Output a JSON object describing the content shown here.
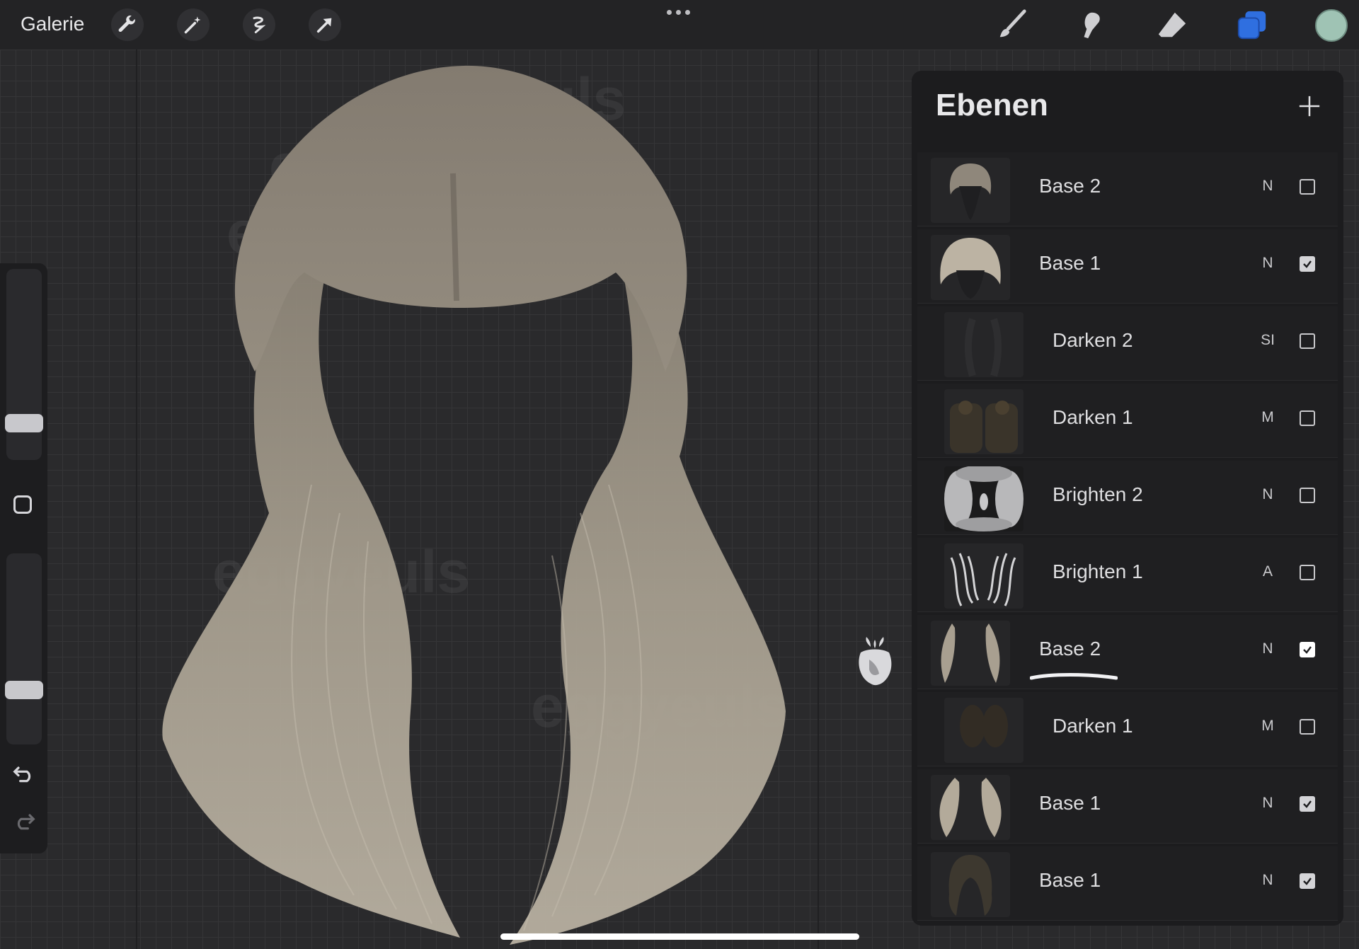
{
  "app": {
    "gallery_label": "Galerie",
    "accent_color": "#2f6fe0",
    "current_color": "#9fc3b4"
  },
  "toolbar": {
    "left_tools": [
      "wrench-icon",
      "magic-wand-icon",
      "selection-icon",
      "transform-arrow-icon"
    ],
    "right_tools": [
      "brush-icon",
      "smudge-icon",
      "eraser-icon",
      "layers-icon"
    ],
    "more_icon": "more-dots-icon"
  },
  "watermark": {
    "text": "eggyeuls"
  },
  "sidebar": {
    "brush_size_level": 0.18,
    "opacity_level": 0.15,
    "icons": [
      "modifier-square-icon",
      "undo-icon",
      "redo-icon"
    ]
  },
  "layers_panel": {
    "title": "Ebenen",
    "add_icon": "plus-icon",
    "layers": [
      {
        "name": "Base 2",
        "blend": "N",
        "visible": false,
        "clipped": false,
        "thumb": "bangs-dark"
      },
      {
        "name": "Base 1",
        "blend": "N",
        "visible": true,
        "clipped": false,
        "thumb": "bangs-light"
      },
      {
        "name": "Darken 2",
        "blend": "SI",
        "visible": false,
        "clipped": true,
        "thumb": "dark"
      },
      {
        "name": "Darken 1",
        "blend": "M",
        "visible": false,
        "clipped": true,
        "thumb": "dark-brown"
      },
      {
        "name": "Brighten 2",
        "blend": "N",
        "visible": false,
        "clipped": true,
        "thumb": "bright-glow"
      },
      {
        "name": "Brighten 1",
        "blend": "A",
        "visible": false,
        "clipped": true,
        "thumb": "bright-strands"
      },
      {
        "name": "Base 2",
        "blend": "N",
        "visible": true,
        "clipped": false,
        "thumb": "long-hair-light",
        "highlighted": true
      },
      {
        "name": "Darken 1",
        "blend": "M",
        "visible": false,
        "clipped": true,
        "thumb": "dark-brown"
      },
      {
        "name": "Base 1",
        "blend": "N",
        "visible": true,
        "clipped": false,
        "thumb": "long-hair-light"
      },
      {
        "name": "Base 1",
        "blend": "N",
        "visible": true,
        "clipped": false,
        "thumb": "hair-dark"
      }
    ]
  }
}
